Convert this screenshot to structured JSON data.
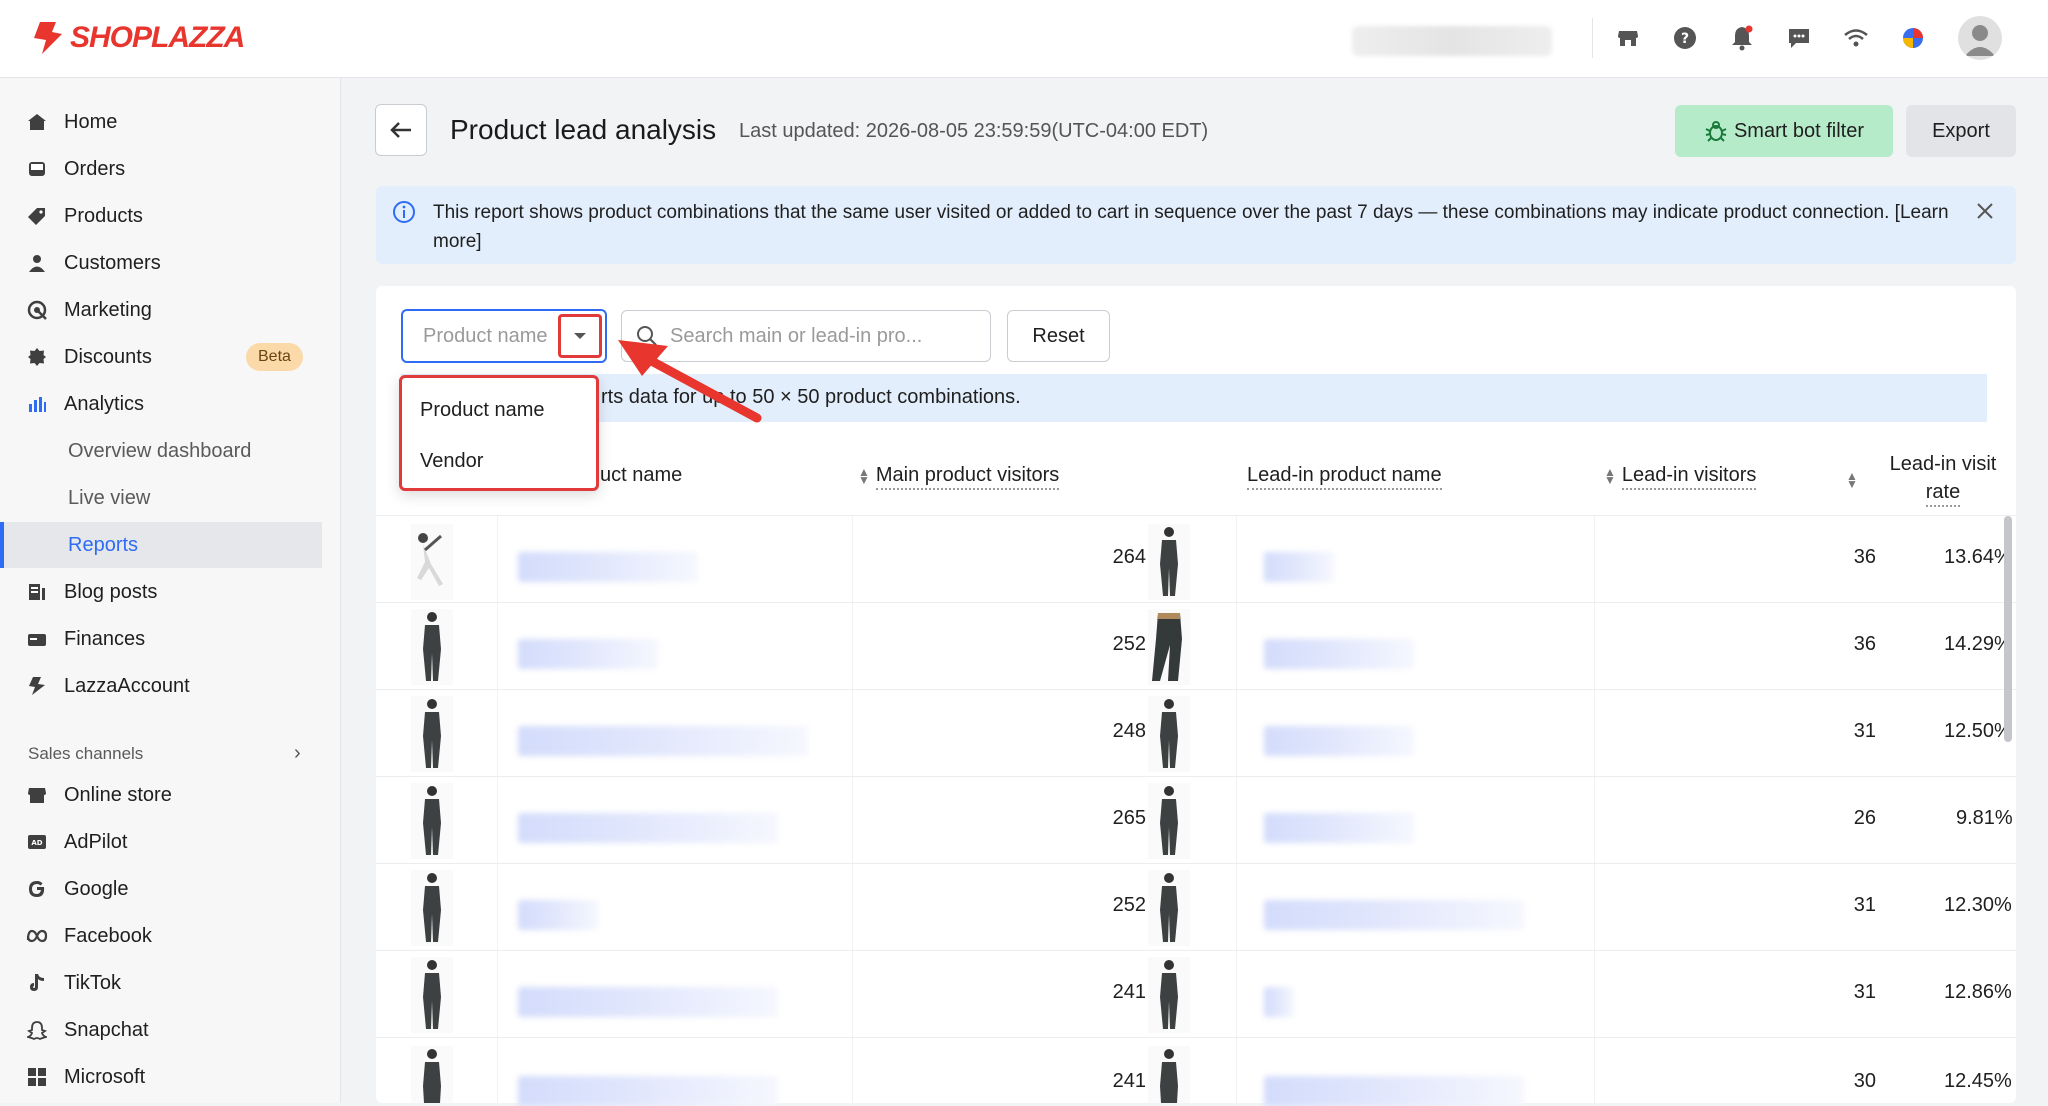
{
  "brand": {
    "name": "SHOPLAZZA",
    "color": "#e8362f"
  },
  "topbar": {
    "icons": [
      "store-icon",
      "help-icon",
      "bell-icon",
      "chat-icon",
      "wifi-icon",
      "app-icon",
      "avatar"
    ]
  },
  "sidebar": {
    "items": [
      {
        "label": "Home",
        "icon": "home-icon"
      },
      {
        "label": "Orders",
        "icon": "orders-icon"
      },
      {
        "label": "Products",
        "icon": "products-icon"
      },
      {
        "label": "Customers",
        "icon": "customers-icon"
      },
      {
        "label": "Marketing",
        "icon": "marketing-icon"
      },
      {
        "label": "Discounts",
        "icon": "discounts-icon",
        "badge": "Beta"
      },
      {
        "label": "Analytics",
        "icon": "analytics-icon"
      },
      {
        "label": "Blog posts",
        "icon": "blog-icon"
      },
      {
        "label": "Finances",
        "icon": "finances-icon"
      },
      {
        "label": "LazzaAccount",
        "icon": "lazza-icon"
      }
    ],
    "analytics_sub": [
      "Overview dashboard",
      "Live view",
      "Reports"
    ],
    "active_sub": "Reports",
    "sales_channels_label": "Sales channels",
    "channels": [
      {
        "label": "Online store",
        "icon": "store-icon"
      },
      {
        "label": "AdPilot",
        "icon": "adpilot-icon"
      },
      {
        "label": "Google",
        "icon": "google-icon"
      },
      {
        "label": "Facebook",
        "icon": "meta-icon"
      },
      {
        "label": "TikTok",
        "icon": "tiktok-icon"
      },
      {
        "label": "Snapchat",
        "icon": "snapchat-icon"
      },
      {
        "label": "Microsoft",
        "icon": "microsoft-icon"
      }
    ]
  },
  "header": {
    "title": "Product lead analysis",
    "last_updated": "Last updated: 2026-08-05 23:59:59(UTC-04:00 EDT)",
    "smart_bot_label": "Smart bot filter",
    "export_label": "Export"
  },
  "banner": {
    "text": "This report shows product combinations that the same user visited or added to cart in sequence over the past 7 days — these combinations may indicate product connection. [Learn more]"
  },
  "filters": {
    "select_value": "Product name",
    "search_placeholder": "Search main or lead-in pro...",
    "reset_label": "Reset",
    "options": [
      "Product name",
      "Vendor"
    ]
  },
  "notice": {
    "text": "rts data for up to 50 × 50 product combinations."
  },
  "table": {
    "columns": [
      "uct name",
      "Main product visitors",
      "Lead-in product name",
      "Lead-in visitors",
      "Lead-in visit",
      "rate"
    ],
    "rows": [
      {
        "main_visitors": "264",
        "lead_visitors": "36",
        "rate": "13.64%"
      },
      {
        "main_visitors": "252",
        "lead_visitors": "36",
        "rate": "14.29%"
      },
      {
        "main_visitors": "248",
        "lead_visitors": "31",
        "rate": "12.50%"
      },
      {
        "main_visitors": "265",
        "lead_visitors": "26",
        "rate": "9.81%"
      },
      {
        "main_visitors": "252",
        "lead_visitors": "31",
        "rate": "12.30%"
      },
      {
        "main_visitors": "241",
        "lead_visitors": "31",
        "rate": "12.86%"
      },
      {
        "main_visitors": "241",
        "lead_visitors": "30",
        "rate": "12.45%"
      }
    ]
  },
  "colors": {
    "accent": "#2f6cf6",
    "highlight": "#e03a3a",
    "bot_button": "#b5ebc9"
  }
}
